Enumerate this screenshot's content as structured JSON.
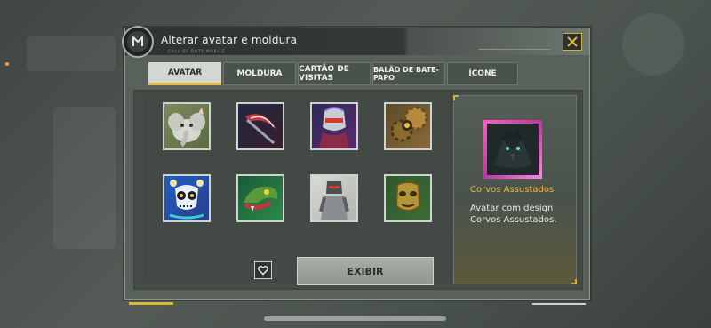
{
  "window": {
    "title": "Alterar avatar e moldura",
    "subtitle": "CALL OF DUTY MOBILE"
  },
  "tabs": [
    {
      "label": "AVATAR",
      "active": true
    },
    {
      "label": "MOLDURA",
      "active": false
    },
    {
      "label": "CARTÃO DE VISITAS",
      "active": false
    },
    {
      "label": "BALÃO DE BATE-PAPO",
      "active": false
    },
    {
      "label": "ÍCONE",
      "active": false
    }
  ],
  "avatars": [
    {
      "icon": "elephant-avatar-icon"
    },
    {
      "icon": "scythe-avatar-icon"
    },
    {
      "icon": "robot-soldier-avatar-icon"
    },
    {
      "icon": "steampunk-gear-avatar-icon"
    },
    {
      "icon": "sugar-skull-avatar-icon"
    },
    {
      "icon": "snake-avatar-icon"
    },
    {
      "icon": "armored-soldier-avatar-icon"
    },
    {
      "icon": "golden-mask-avatar-icon"
    }
  ],
  "actions": {
    "show_label": "EXIBIR",
    "favorite_icon": "heart-icon",
    "close_icon": "close-icon"
  },
  "detail": {
    "name": "Corvos Assustados",
    "description": "Avatar com design Corvos Assustados.",
    "preview_icon": "raven-avatar-icon",
    "frame_color": "#e84fbf"
  },
  "colors": {
    "accent": "#e1b937",
    "name_highlight": "#e7b846"
  }
}
